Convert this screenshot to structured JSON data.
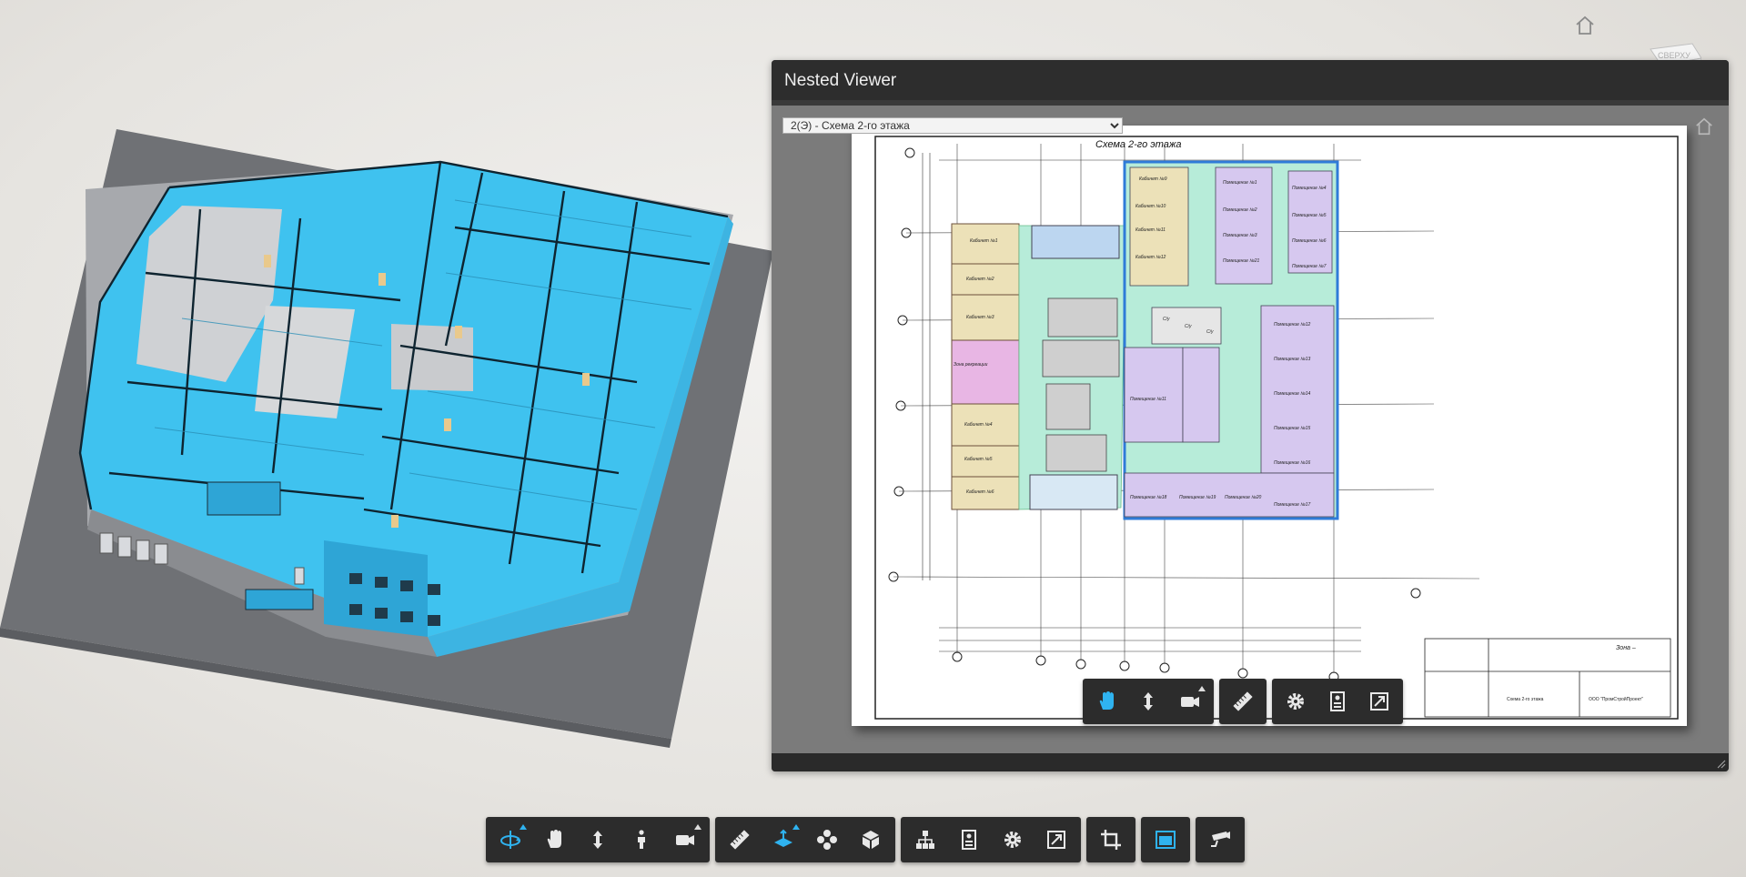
{
  "app": {
    "accent_color": "#2fb3f0",
    "toolbar_bg": "#2c2c2c"
  },
  "navigation": {
    "home_icon": "home-icon",
    "viewcube_label": "СВЕРХУ"
  },
  "nested_viewer": {
    "title": "Nested Viewer",
    "sheet_selector": {
      "selected": "2(Э) - Схема 2-го этажа",
      "options": [
        "2(Э) - Схема 2-го этажа"
      ]
    },
    "drawing": {
      "title": "Схема 2-го этажа",
      "title_block": {
        "zone": "Зона –",
        "sheet_name": "Схема 2-го этажа",
        "company": "ООО \"ПромСтройПроект\""
      },
      "rooms": [
        "Кабинет №1",
        "Кабинет №2",
        "Кабинет №3",
        "Зона рекреации",
        "Кабинет №4",
        "Кабинет №5",
        "Кабинет №6",
        "Кабинет №9",
        "Кабинет №10",
        "Кабинет №11",
        "Кабинет №12",
        "Помещение №1",
        "Помещение №2",
        "Помещение №3",
        "Помещение №21",
        "Помещение №4",
        "Помещение №5",
        "Помещение №6",
        "Помещение №7",
        "Помещение №12",
        "Помещение №13",
        "Помещение №14",
        "Помещение №15",
        "Помещение №16",
        "Помещение №11",
        "Помещение №17",
        "Помещение №18",
        "Помещение №19",
        "Помещение №20",
        "С/у",
        "С/у",
        "С/у"
      ]
    },
    "toolbar": [
      {
        "name": "pan-tool",
        "icon": "hand-icon",
        "active": true
      },
      {
        "name": "zoom-tool",
        "icon": "zoom-arrows-icon",
        "active": false
      },
      {
        "name": "camera-tool",
        "icon": "camera-icon",
        "active": false,
        "submenu": true
      },
      {
        "name": "measure-tool",
        "icon": "ruler-icon",
        "active": false
      },
      {
        "name": "settings-tool",
        "icon": "gear-icon",
        "active": false
      },
      {
        "name": "properties-tool",
        "icon": "properties-icon",
        "active": false
      },
      {
        "name": "fullscreen-tool",
        "icon": "fullscreen-icon",
        "active": false
      }
    ]
  },
  "main_toolbar": {
    "groups": [
      [
        {
          "name": "orbit-tool",
          "icon": "orbit-icon",
          "active": true,
          "submenu": true
        },
        {
          "name": "pan-tool",
          "icon": "hand-icon",
          "active": false
        },
        {
          "name": "zoom-tool",
          "icon": "zoom-arrows-icon",
          "active": false
        },
        {
          "name": "walk-tool",
          "icon": "person-icon",
          "active": false
        },
        {
          "name": "camera-tool",
          "icon": "camera-icon",
          "active": false,
          "submenu": true
        }
      ],
      [
        {
          "name": "measure-tool",
          "icon": "ruler-icon",
          "active": false
        },
        {
          "name": "section-tool",
          "icon": "section-plane-icon",
          "active": true,
          "submenu": true
        },
        {
          "name": "explode-tool",
          "icon": "explode-icon",
          "active": false
        },
        {
          "name": "model-browser-tool",
          "icon": "cube-icon",
          "active": false
        }
      ],
      [
        {
          "name": "structure-tool",
          "icon": "hierarchy-icon",
          "active": false
        },
        {
          "name": "properties-tool",
          "icon": "properties-icon",
          "active": false
        },
        {
          "name": "settings-tool",
          "icon": "gear-icon",
          "active": false
        },
        {
          "name": "fullscreen-tool",
          "icon": "fullscreen-icon",
          "active": false
        }
      ],
      [
        {
          "name": "crop-tool",
          "icon": "crop-icon",
          "active": false
        }
      ],
      [
        {
          "name": "nested-viewer-tool",
          "icon": "window-icon",
          "active": true
        }
      ],
      [
        {
          "name": "camera-view-tool",
          "icon": "security-camera-icon",
          "active": false
        }
      ]
    ]
  }
}
